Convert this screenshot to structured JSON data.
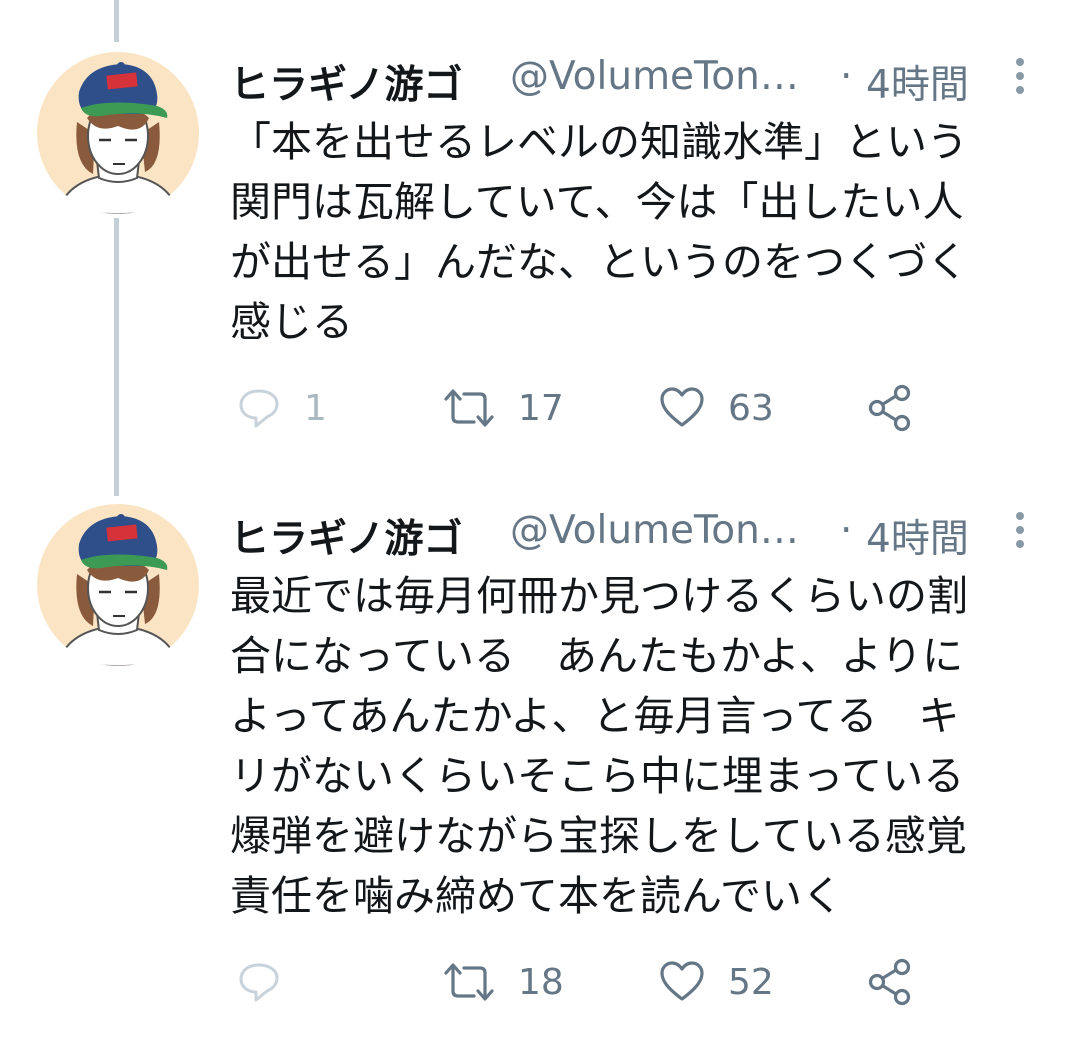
{
  "colors": {
    "secondary_text": "#657786",
    "icon": "#8899a6",
    "thread_line": "#c4cfd6",
    "avatar_bg": "#fbe4c4"
  },
  "tweets": [
    {
      "name": "ヒラギノ游ゴ",
      "handle": "@VolumeTon…",
      "separator": "·",
      "time": "4時間",
      "lines": [
        "「本を出せるレベルの知識水準」という",
        "関門は瓦解していて、今は「出したい人",
        "が出せる」んだな、というのをつくづく",
        "感じる"
      ],
      "reply_count": "1",
      "retweet_count": "17",
      "like_count": "63"
    },
    {
      "name": "ヒラギノ游ゴ",
      "handle": "@VolumeTon…",
      "separator": "·",
      "time": "4時間",
      "lines": [
        "最近では毎月何冊か見つけるくらいの割",
        "合になっている　あんたもかよ、よりに",
        "よってあんたかよ、と毎月言ってる　キ",
        "リがないくらいそこら中に埋まっている",
        "爆弾を避けながら宝探しをしている感覚",
        "責任を噛み締めて本を読んでいく"
      ],
      "reply_count": "",
      "retweet_count": "18",
      "like_count": "52"
    }
  ]
}
